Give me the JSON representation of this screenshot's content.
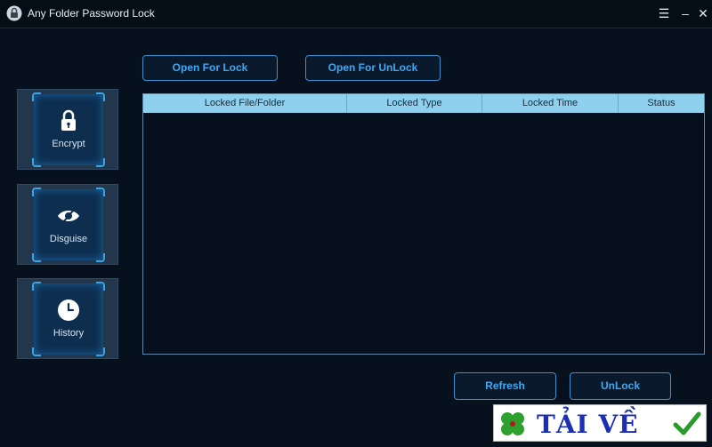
{
  "window": {
    "title": "Any Folder Password Lock"
  },
  "sidebar": {
    "items": [
      {
        "label": "Encrypt",
        "icon": "lock-icon"
      },
      {
        "label": "Disguise",
        "icon": "eye-icon"
      },
      {
        "label": "History",
        "icon": "clock-icon"
      }
    ]
  },
  "toolbar": {
    "open_lock_label": "Open For Lock",
    "open_unlock_label": "Open For UnLock"
  },
  "table": {
    "columns": [
      "Locked File/Folder",
      "Locked Type",
      "Locked Time",
      "Status"
    ],
    "rows": []
  },
  "actions": {
    "refresh_label": "Refresh",
    "unlock_label": "UnLock"
  },
  "watermark": {
    "text": "TẢI VỀ"
  },
  "colors": {
    "background": "#07111e",
    "accent": "#3ea8f0",
    "table_header": "#8fd0ef"
  }
}
